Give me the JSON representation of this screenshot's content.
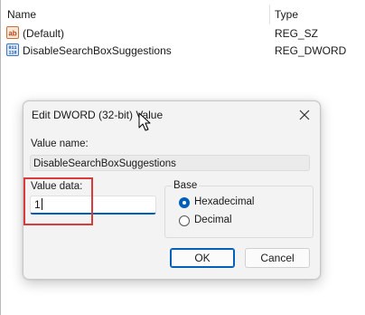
{
  "list": {
    "header": {
      "name": "Name",
      "type": "Type"
    },
    "rows": [
      {
        "name": "(Default)",
        "type": "REG_SZ",
        "icon": "ab-string-icon"
      },
      {
        "name": "DisableSearchBoxSuggestions",
        "type": "REG_DWORD",
        "icon": "binary-value-icon"
      }
    ]
  },
  "dialog": {
    "title": "Edit DWORD (32-bit) Value",
    "value_name_label": "Value name:",
    "value_name": "DisableSearchBoxSuggestions",
    "value_data_label": "Value data:",
    "value_data": "1",
    "base_label": "Base",
    "base_options": [
      "Hexadecimal",
      "Decimal"
    ],
    "base_selected": "Hexadecimal",
    "ok_label": "OK",
    "cancel_label": "Cancel"
  },
  "colors": {
    "accent": "#005fb8",
    "highlight": "#d93a3a"
  }
}
